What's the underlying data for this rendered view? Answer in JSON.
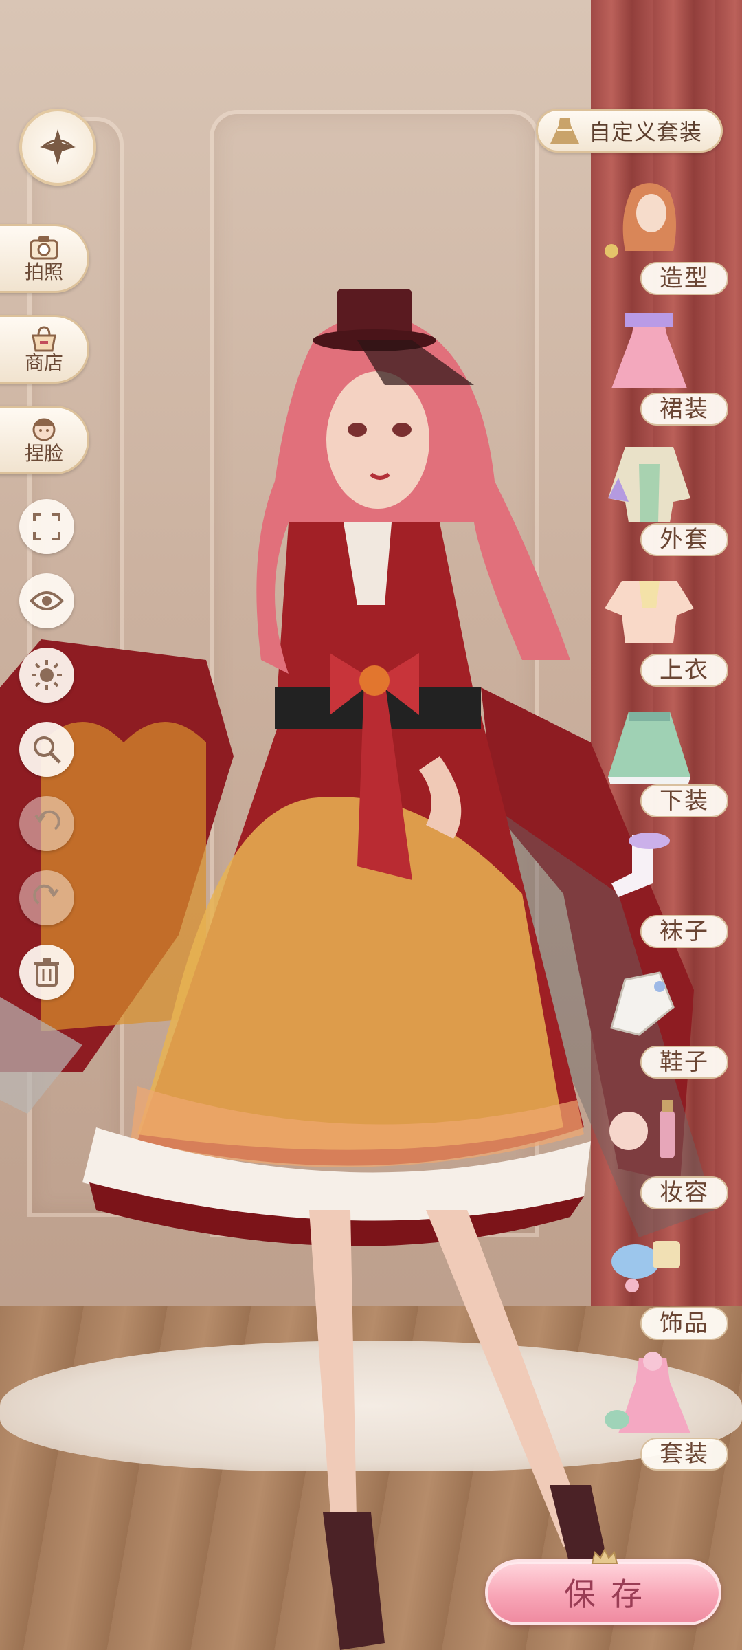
{
  "left_menu": {
    "photo_label": "拍照",
    "shop_label": "商店",
    "face_label": "捏脸"
  },
  "right_menu": {
    "custom_outfit_label": "自定义套装",
    "categories": [
      {
        "label": "造型"
      },
      {
        "label": "裙装"
      },
      {
        "label": "外套"
      },
      {
        "label": "上衣"
      },
      {
        "label": "下装"
      },
      {
        "label": "袜子"
      },
      {
        "label": "鞋子"
      },
      {
        "label": "妆容"
      },
      {
        "label": "饰品"
      },
      {
        "label": "套装"
      }
    ]
  },
  "footer": {
    "save_label": "保存"
  },
  "colors": {
    "accent_gold": "#dcc19a",
    "label_brown": "#6a4533",
    "save_pink": "#f8a6b7",
    "dress_red": "#9e1f24"
  }
}
